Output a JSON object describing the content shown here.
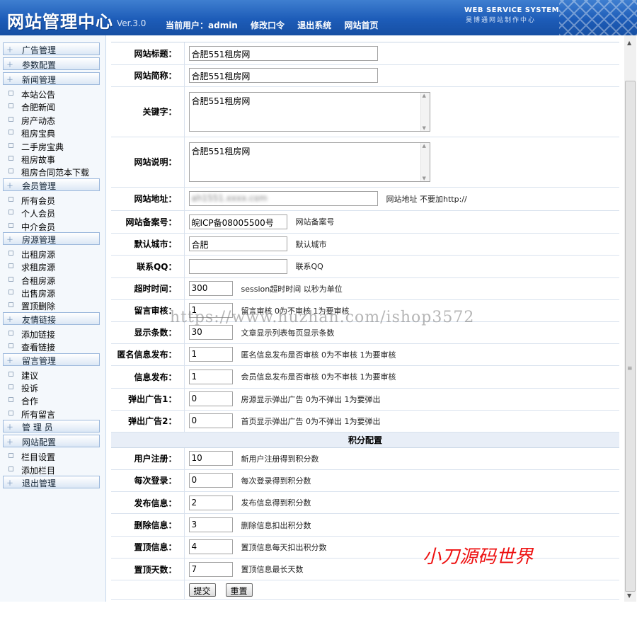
{
  "header": {
    "title": "网站管理中心",
    "version": "Ver.3.0",
    "current_user": "当前用户：admin",
    "change_password": "修改口令",
    "logout": "退出系统",
    "site_home": "网站首页",
    "brand_en": "WEB SERVICE SYSTEM",
    "brand_cn": "昊博通网站制作中心"
  },
  "sidebar": [
    {
      "type": "section",
      "label": "广告管理"
    },
    {
      "type": "section",
      "label": "参数配置"
    },
    {
      "type": "section",
      "label": "新闻管理"
    },
    {
      "type": "item",
      "label": "本站公告"
    },
    {
      "type": "item",
      "label": "合肥新闻"
    },
    {
      "type": "item",
      "label": "房产动态"
    },
    {
      "type": "item",
      "label": "租房宝典"
    },
    {
      "type": "item",
      "label": "二手房宝典"
    },
    {
      "type": "item",
      "label": "租房故事"
    },
    {
      "type": "item",
      "label": "租房合同范本下载"
    },
    {
      "type": "section",
      "label": "会员管理"
    },
    {
      "type": "item",
      "label": "所有会员"
    },
    {
      "type": "item",
      "label": "个人会员"
    },
    {
      "type": "item",
      "label": "中介会员"
    },
    {
      "type": "section",
      "label": "房源管理"
    },
    {
      "type": "item",
      "label": "出租房源"
    },
    {
      "type": "item",
      "label": "求租房源"
    },
    {
      "type": "item",
      "label": "合租房源"
    },
    {
      "type": "item",
      "label": "出售房源"
    },
    {
      "type": "item",
      "label": "置顶删除"
    },
    {
      "type": "section",
      "label": "友情链接"
    },
    {
      "type": "item",
      "label": "添加链接"
    },
    {
      "type": "item",
      "label": "查看链接"
    },
    {
      "type": "section",
      "label": "留言管理"
    },
    {
      "type": "item",
      "label": "建议"
    },
    {
      "type": "item",
      "label": "投诉"
    },
    {
      "type": "item",
      "label": "合作"
    },
    {
      "type": "item",
      "label": "所有留言"
    },
    {
      "type": "section",
      "label": "管 理 员"
    },
    {
      "type": "section",
      "label": "网站配置"
    },
    {
      "type": "item",
      "label": "栏目设置"
    },
    {
      "type": "item",
      "label": "添加栏目"
    },
    {
      "type": "section",
      "label": "退出管理"
    }
  ],
  "form": {
    "rows": [
      {
        "label": "网站标题：",
        "kind": "input",
        "value": "合肥551租房网",
        "width": 267,
        "hint": "",
        "h": 31
      },
      {
        "label": "网站简称：",
        "kind": "input",
        "value": "合肥551租房网",
        "width": 267,
        "hint": "",
        "h": 31
      },
      {
        "label": "关键字：",
        "kind": "textarea",
        "value": "合肥551租房网",
        "hint": "",
        "h": 71
      },
      {
        "label": "网站说明：",
        "kind": "textarea",
        "value": "合肥551租房网",
        "hint": "",
        "h": 71
      },
      {
        "label": "网站地址：",
        "kind": "input",
        "value": "ah1551.xxxx.com",
        "width": 267,
        "hint": "网站地址 不要加http://",
        "blur": true,
        "h": 33
      },
      {
        "label": "网站备案号：",
        "kind": "input",
        "value": "皖ICP备08005500号",
        "width": 139,
        "hint": "网站备案号",
        "h": 32
      },
      {
        "label": "默认城市：",
        "kind": "input",
        "value": "合肥",
        "width": 139,
        "hint": "默认城市",
        "h": 31
      },
      {
        "label": "联系QQ：",
        "kind": "input",
        "value": "",
        "width": 139,
        "hint": "联系QQ",
        "h": 32
      },
      {
        "label": "超时时间：",
        "kind": "input",
        "value": "300",
        "width": 62,
        "hint": "session超时时间 以秒为单位",
        "h": 31
      },
      {
        "label": "留言审核：",
        "kind": "input",
        "value": "1",
        "width": 62,
        "hint": "留言审核 0为不审核 1为要审核",
        "h": 31
      },
      {
        "label": "显示条数：",
        "kind": "input",
        "value": "30",
        "width": 62,
        "hint": "文章显示列表每页显示条数",
        "h": 31
      },
      {
        "label": "匿名信息发布：",
        "kind": "input",
        "value": "1",
        "width": 62,
        "hint": "匿名信息发布是否审核 0为不审核 1为要审核",
        "h": 31
      },
      {
        "label": "信息发布：",
        "kind": "input",
        "value": "1",
        "width": 62,
        "hint": "会员信息发布是否审核 0为不审核 1为要审核",
        "h": 32
      },
      {
        "label": "弹出广告1：",
        "kind": "input",
        "value": "0",
        "width": 62,
        "hint": "房源显示弹出广告 0为不弹出 1为要弹出",
        "h": 31
      },
      {
        "label": "弹出广告2：",
        "kind": "input",
        "value": "0",
        "width": 62,
        "hint": "首页显示弹出广告 0为不弹出 1为要弹出",
        "h": 31
      }
    ],
    "points_section": "积分配置",
    "points_rows": [
      {
        "label": "用户注册：",
        "value": "10",
        "hint": "新用户注册得到积分数"
      },
      {
        "label": "每次登录：",
        "value": "0",
        "hint": "每次登录得到积分数"
      },
      {
        "label": "发布信息：",
        "value": "2",
        "hint": "发布信息得到积分数"
      },
      {
        "label": "删除信息：",
        "value": "3",
        "hint": "删除信息扣出积分数"
      },
      {
        "label": "置顶信息：",
        "value": "4",
        "hint": "置顶信息每天扣出积分数"
      },
      {
        "label": "置顶天数：",
        "value": "7",
        "hint": "置顶信息最长天数"
      }
    ],
    "submit": "提交",
    "reset": "重置"
  },
  "watermark": "https://www.huzhan.com/ishop3572",
  "stamp": "小刀源码世界"
}
